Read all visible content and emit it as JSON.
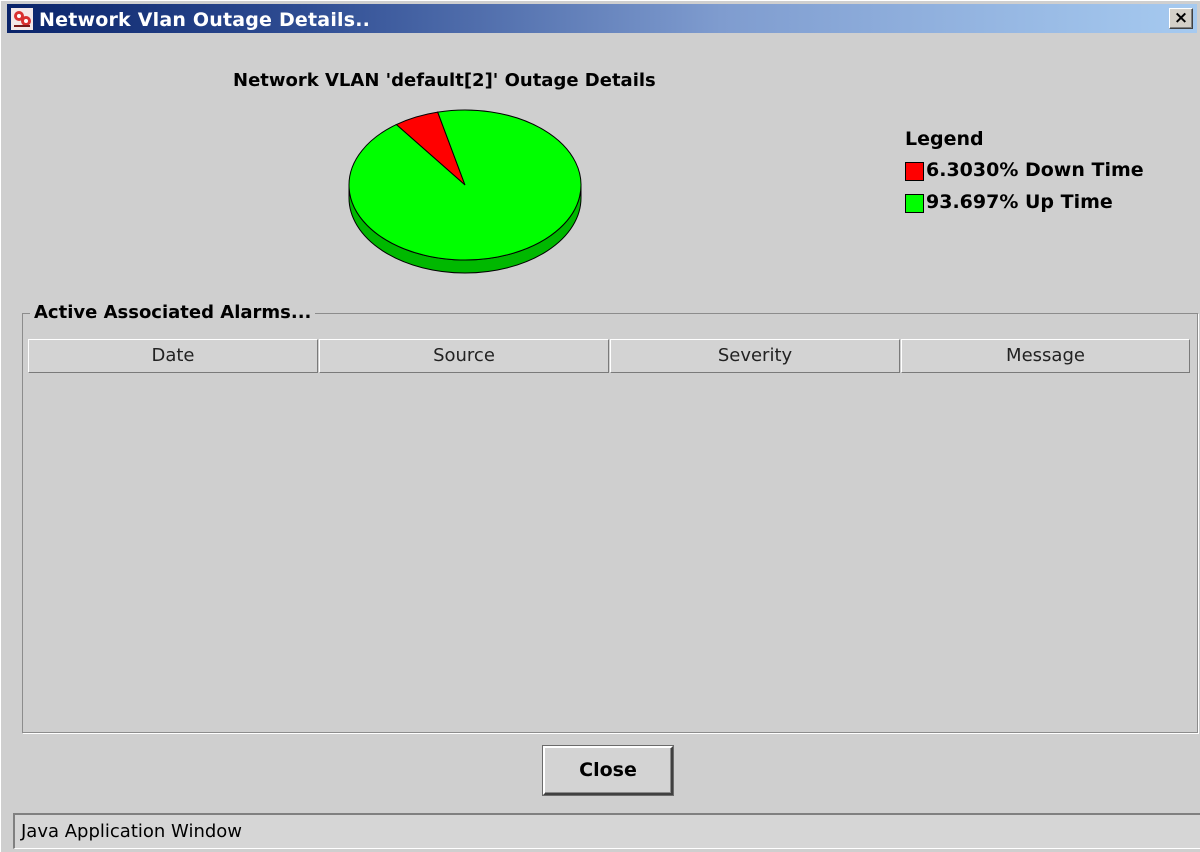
{
  "window": {
    "title": "Network Vlan Outage Details..",
    "close_glyph": "×"
  },
  "chart_title": "Network VLAN 'default[2]' Outage Details",
  "chart_data": {
    "type": "pie",
    "title": "Network VLAN 'default[2]' Outage Details",
    "slices": [
      {
        "label": "6.3030% Down Time",
        "value": 6.303,
        "color": "#ff0000"
      },
      {
        "label": "93.697% Up Time",
        "value": 93.697,
        "color": "#00ff00"
      }
    ],
    "legend_title": "Legend",
    "legend_placement": "right"
  },
  "legend": {
    "title": "Legend",
    "items": [
      {
        "label": "6.3030% Down Time",
        "color": "#ff0000"
      },
      {
        "label": "93.697% Up Time",
        "color": "#00ff00"
      }
    ]
  },
  "alarms": {
    "section_title": "Active Associated Alarms...",
    "columns": [
      "Date",
      "Source",
      "Severity",
      "Message"
    ],
    "rows": []
  },
  "buttons": {
    "close_label": "Close"
  },
  "statusbar": {
    "text": "Java Application Window"
  },
  "icons": {
    "app_icon": "network-app-icon",
    "close_icon": "close-icon"
  }
}
